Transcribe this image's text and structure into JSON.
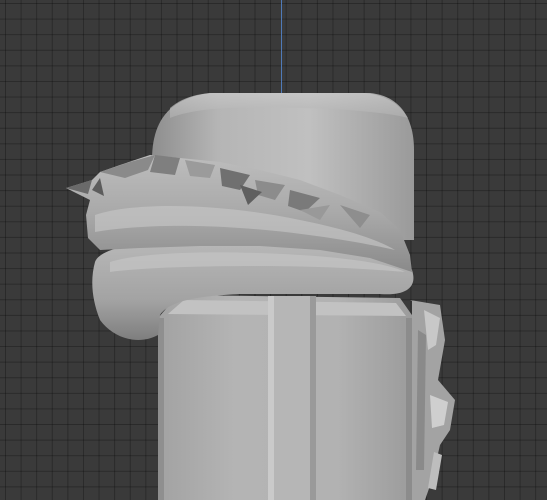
{
  "viewport": {
    "background": "#3a3a3a",
    "grid_line_color": "#2c2c2c",
    "axis_color": "#4f7ab8",
    "shading": "solid-gray"
  },
  "scene": {
    "objects": [
      {
        "name": "head-mesh",
        "material": "#b9b9b9"
      },
      {
        "name": "headband-mesh",
        "material": "#a6a6a6"
      },
      {
        "name": "torso-mesh",
        "material": "#b0b0b0"
      },
      {
        "name": "side-tail-mesh",
        "material": "#9c9c9c"
      }
    ]
  }
}
